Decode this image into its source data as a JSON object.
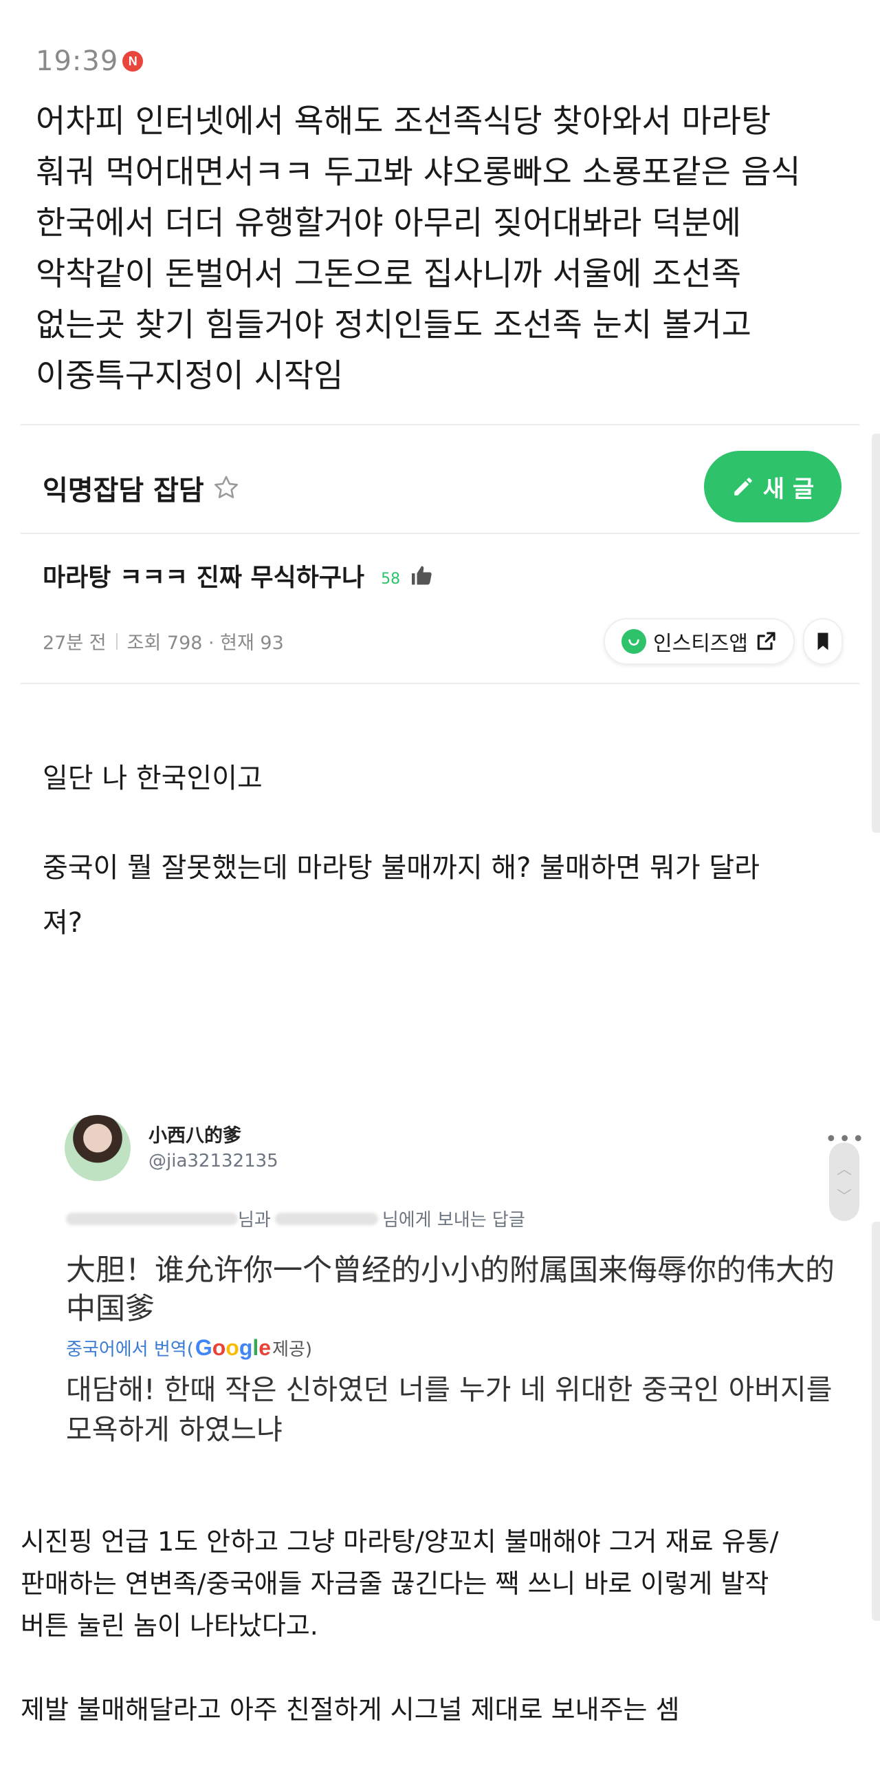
{
  "status": {
    "time": "19:39",
    "badge": "N"
  },
  "top_comment": {
    "lines": [
      "어차피 인터넷에서 욕해도 조선족식당 찾아와서 마라탕",
      "훠궈 먹어대면서ㅋㅋ 두고봐 샤오롱빠오 소룡포같은 음식",
      "한국에서 더더 유행할거야 아무리 짖어대봐라 덕분에",
      "악착같이 돈벌어서 그돈으로 집사니까 서울에 조선족",
      "없는곳 찾기 힘들거야 정치인들도 조선족 눈치 볼거고",
      "이중특구지정이 시작임"
    ]
  },
  "board": {
    "title": "익명잡담 잡담",
    "new_post_label": "새 글",
    "star_icon": "star-outline-icon",
    "accent_color": "#2ec26a"
  },
  "post": {
    "title": "마라탕 ㅋㅋㅋ 진짜 무식하구나",
    "likes": "58",
    "time_ago": "27분 전",
    "views": "조회 798 · 현재 93",
    "app_button_label": "인스티즈앱",
    "body": [
      "일단 나 한국인이고",
      "중국이 뭘 잘못했는데 마라탕 불매까지 해? 불매하면 뭐가 달라",
      "져?"
    ]
  },
  "embed": {
    "display_name": "小西八的爹",
    "handle": "@jia32132135",
    "reply_to_a": "님과",
    "reply_to_b": "님에게 보내는 답글",
    "original_text": "大胆！谁允许你一个曾经的小小的附属国来侮辱你的伟大的中国爹",
    "translate_prefix": "중국어에서 번역(",
    "translate_brand": "Google",
    "translate_suffix": " 제공)",
    "translated_text": "대담해! 한때 작은 신하였던 너를 누가 네 위대한 중국인 아버지를 모욕하게 하였느냐"
  },
  "footer_text": {
    "lines": [
      "시진핑 언급 1도 안하고 그냥 마라탕/양꼬치 불매해야 그거 재료 유통/",
      "판매하는 연변족/중국애들 자금줄 끊긴다는 짹 쓰니 바로 이렇게 발작",
      "버튼 눌린 놈이 나타났다고.",
      "",
      "제발 불매해달라고 아주 친절하게 시그널 제대로 보내주는 셈"
    ]
  }
}
